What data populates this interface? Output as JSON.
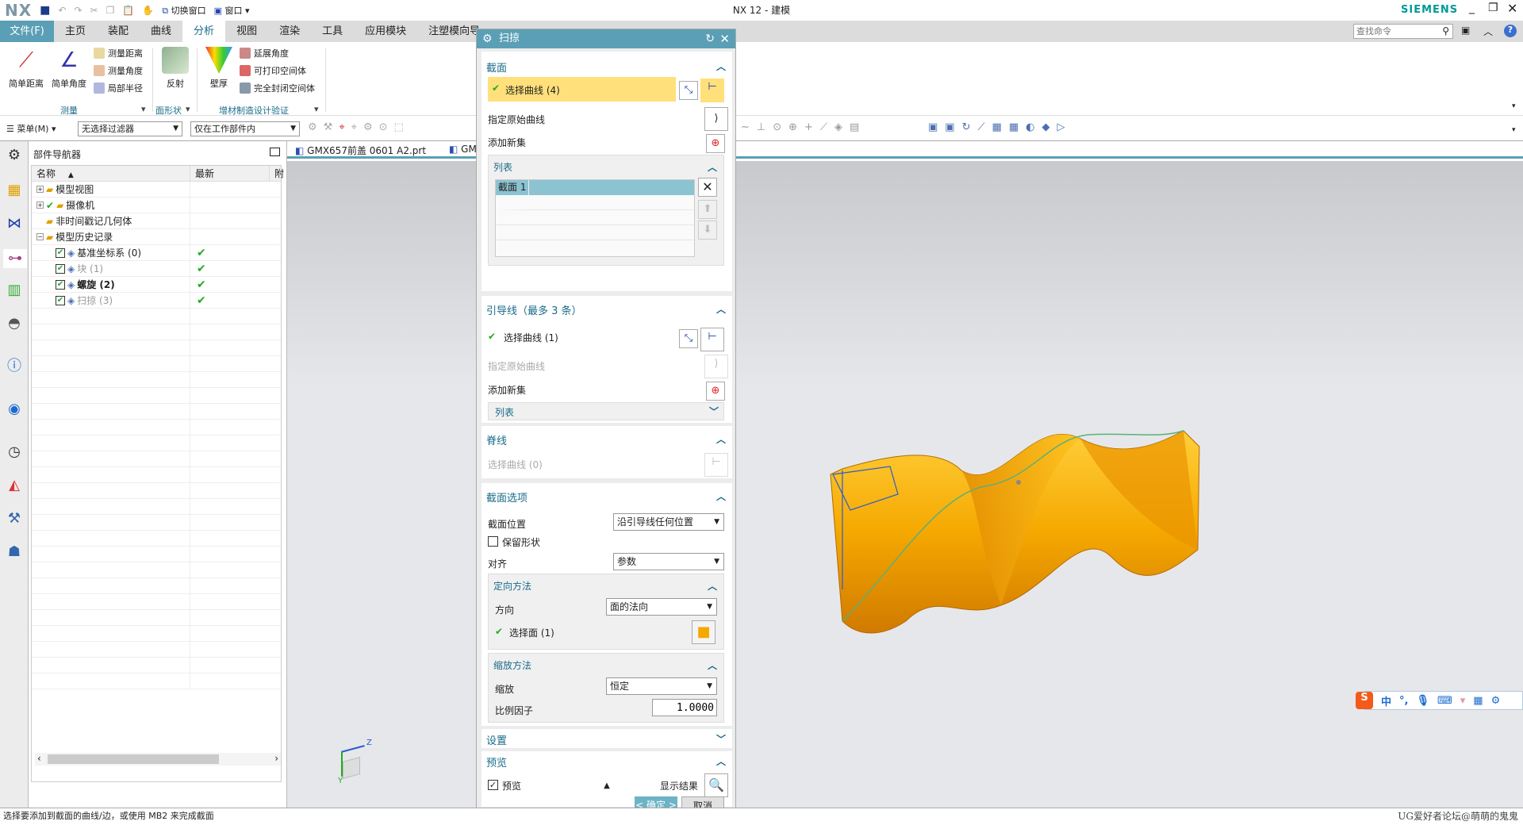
{
  "app": {
    "logo": "NX",
    "title": "NX 12 - 建模",
    "brand": "SIEMENS",
    "quick_access": {
      "switch_window": "切换窗口",
      "window": "窗口"
    },
    "search_placeholder": "查找命令"
  },
  "ribbon": {
    "tabs": [
      "文件(F)",
      "主页",
      "装配",
      "曲线",
      "分析",
      "视图",
      "渲染",
      "工具",
      "应用模块",
      "注塑模向导"
    ],
    "active_tab": "分析",
    "groups": [
      {
        "label": "测量",
        "large": [
          "简单距离",
          "简单角度"
        ],
        "small": [
          "测量距离",
          "测量角度",
          "局部半径"
        ]
      },
      {
        "label": "面形状",
        "large": [
          "反射"
        ]
      },
      {
        "label": "增材制造设计验证",
        "large": [
          "壁厚"
        ],
        "small": [
          "延展角度",
          "可打印空间体",
          "完全封闭空间体"
        ]
      }
    ]
  },
  "toolbar": {
    "menu": "菜单(M)",
    "filter": "无选择过滤器",
    "scope": "仅在工作部件内"
  },
  "navigator": {
    "title": "部件导航器",
    "columns": [
      "名称",
      "最新",
      "附"
    ],
    "items": [
      {
        "label": "模型视图",
        "level": 0,
        "expand": "+"
      },
      {
        "label": "摄像机",
        "level": 0,
        "expand": "+",
        "check": true
      },
      {
        "label": "非时间戳记几何体",
        "level": 0
      },
      {
        "label": "模型历史记录",
        "level": 0,
        "expand": "−"
      },
      {
        "label": "基准坐标系 (0)",
        "level": 1,
        "latest": "✔",
        "style": "normal"
      },
      {
        "label": "块 (1)",
        "level": 1,
        "latest": "✔",
        "style": "gray"
      },
      {
        "label": "螺旋 (2)",
        "level": 1,
        "latest": "✔",
        "style": "bold"
      },
      {
        "label": "扫掠 (3)",
        "level": 1,
        "latest": "✔",
        "style": "gray"
      }
    ]
  },
  "doc_tabs": [
    "GMX657前盖 0601 A2.prt",
    "GM"
  ],
  "dialog": {
    "title": "扫掠",
    "section": {
      "header": "截面",
      "select_curve": "选择曲线 (4)",
      "specify_origin": "指定原始曲线",
      "add_set": "添加新集",
      "list": {
        "header": "列表",
        "rows": [
          "截面 1"
        ]
      }
    },
    "guide": {
      "header": "引导线（最多 3 条）",
      "select_curve": "选择曲线 (1)",
      "specify_origin": "指定原始曲线",
      "add_set": "添加新集",
      "list": "列表"
    },
    "spine": {
      "header": "脊线",
      "select_curve": "选择曲线 (0)"
    },
    "options": {
      "header": "截面选项",
      "position_label": "截面位置",
      "position_value": "沿引导线任何位置",
      "preserve_shape": "保留形状",
      "preserve_checked": false,
      "align_label": "对齐",
      "align_value": "参数",
      "orientation": {
        "header": "定向方法",
        "dir_label": "方向",
        "dir_value": "面的法向",
        "select_face": "选择面 (1)"
      },
      "scaling": {
        "header": "缩放方法",
        "scale_label": "缩放",
        "scale_value": "恒定",
        "factor_label": "比例因子",
        "factor_value": "1.0000"
      }
    },
    "settings": {
      "header": "设置"
    },
    "preview": {
      "header": "预览",
      "checkbox": "预览",
      "checked": true,
      "show_result": "显示结果"
    },
    "ok": "< 确定 >",
    "cancel": "取消"
  },
  "viewport": {
    "triad": {
      "z": "Z",
      "y": "Y"
    }
  },
  "ime": {
    "chinese": "中"
  },
  "status": {
    "message": "选择要添加到截面的曲线/边，或使用 MB2 来完成截面",
    "watermark": "UG爱好者论坛@萌萌的鬼鬼"
  },
  "colors": {
    "accent": "#5a9fb5",
    "highlight": "#ffe07a",
    "model": "#f5a800"
  }
}
